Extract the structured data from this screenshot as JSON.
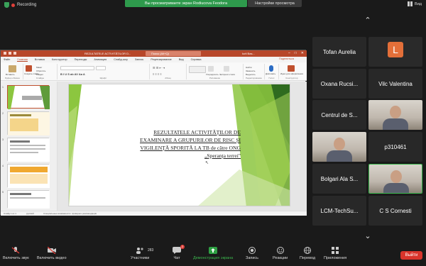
{
  "topbar": {
    "recording_label": "Recording",
    "share_banner": "Вы просматриваете экран Rodiucova Feodora",
    "view_options": "Настройки просмотра",
    "view_label": "Вид"
  },
  "ppt": {
    "file_name": "REZULTATELE ACTIVITĂȚILOR D...",
    "search_placeholder": "Поиск (Alt+Q)",
    "user_name": "Iurii Bas...",
    "tabs": [
      "Файл",
      "Главная",
      "Вставка",
      "Конструктор",
      "Переходы",
      "Анимация",
      "Слайд-шоу",
      "Запись",
      "Рецензирование",
      "Вид",
      "Справка"
    ],
    "active_tab": "Главная",
    "share_label": "Поделиться",
    "ribbon_groups": [
      "Буфер обмена",
      "Слайды",
      "Шрифт",
      "Абзац",
      "Рисование",
      "Редактирование",
      "Голос",
      "Конструктор"
    ],
    "ribbon_labels": {
      "paste": "Вставить",
      "new_slide": "Создать слайд",
      "reuse": "Повторно использовать слайды",
      "layout": "Макет",
      "reset": "Сбросить",
      "section": "Раздел",
      "find": "Найти",
      "replace": "Заменить",
      "select": "Выделить",
      "dictate": "Диктовать",
      "design": "Идеи для оформления",
      "arrange": "Упорядочить",
      "quick_styles": "Экспресс-стили"
    },
    "slide_numbers": [
      "1",
      "2",
      "3",
      "4",
      "5"
    ],
    "slide_title_lines": [
      "REZULTATELE ACTIVITĂȚILOR DE",
      "EXAMINARE A GRUPURILOR DE RISC ȘI",
      "VIGILENȚĂ SPORITĂ LA TB de către ONG",
      "„Speranța terrei\""
    ],
    "status": {
      "slide_of": "Слайд 1 из 1",
      "language": "русский",
      "accessibility": "Специальные возможности: проверьте рекомендации"
    }
  },
  "participants": [
    {
      "name": "Tofan Aurelia",
      "video": false
    },
    {
      "name": "L",
      "label": "",
      "video": false,
      "avatar": true
    },
    {
      "name": "Oxana Rucsi...",
      "video": false
    },
    {
      "name": "Vilc Valentina",
      "video": false
    },
    {
      "name": "Centrul de S...",
      "video": false
    },
    {
      "name": "",
      "video": true
    },
    {
      "name": "",
      "video": true
    },
    {
      "name": "p310461",
      "video": false
    },
    {
      "name": "Bolgari Ala S...",
      "video": false
    },
    {
      "name": "",
      "video": true,
      "speaking": true
    },
    {
      "name": "LCM-TechSu...",
      "video": false
    },
    {
      "name": "C S Cornesti",
      "video": false
    }
  ],
  "toolbar": {
    "mic": "Включить звук",
    "video": "Включить видео",
    "participants": "Участники",
    "participants_count": "283",
    "chat": "Чат",
    "chat_badge": "2",
    "share": "Демонстрация экрана",
    "record": "Запись",
    "reactions": "Реакции",
    "translate": "Перевод",
    "apps": "Приложения",
    "leave": "Выйти"
  },
  "colors": {
    "accent_green": "#2e9a4c",
    "ppt_brand": "#b7472a",
    "leave_red": "#d9342b",
    "avatar_orange": "#e36f39"
  }
}
